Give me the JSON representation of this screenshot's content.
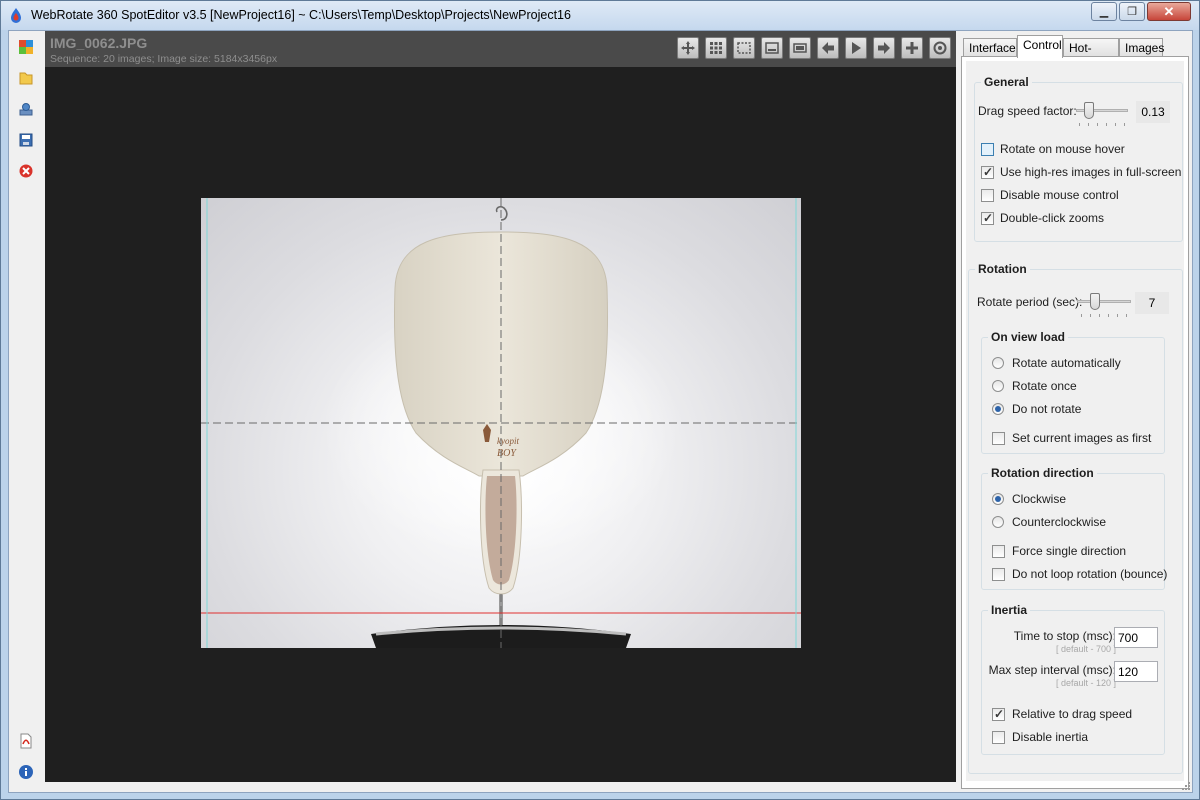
{
  "window": {
    "title": "WebRotate 360 SpotEditor v3.5 [NewProject16] ~ C:\\Users\\Temp\\Desktop\\Projects\\NewProject16"
  },
  "left_toolbar": {
    "items": [
      "cubes-icon",
      "open-folder-icon",
      "publish-icon",
      "save-icon",
      "close-project-icon",
      "pdf-icon",
      "info-icon"
    ]
  },
  "viewer": {
    "image_name": "IMG_0062.JPG",
    "info": "Sequence: 20 images; Image size: 5184x3456px",
    "toolbar": [
      "move-icon",
      "grid-icon",
      "select-region-icon",
      "filmstrip-icon",
      "fit-icon",
      "arrow-left-icon",
      "play-icon",
      "arrow-right-icon",
      "plus-icon",
      "target-icon"
    ],
    "product_logo_line1": "kyopit",
    "product_logo_line2": "BOY"
  },
  "tabs": [
    "Interface",
    "Control",
    "Hot-spots",
    "Images"
  ],
  "active_tab": "Control",
  "general": {
    "title": "General",
    "drag_speed_label": "Drag speed factor:",
    "drag_speed_value": "0.13",
    "drag_speed_fraction": 0.2,
    "options": [
      {
        "label": "Rotate on mouse hover",
        "checked": false
      },
      {
        "label": "Use high-res images in full-screen",
        "checked": true
      },
      {
        "label": "Disable mouse control",
        "checked": false
      },
      {
        "label": "Double-click zooms",
        "checked": true
      }
    ]
  },
  "rotation": {
    "title": "Rotation",
    "period_label": "Rotate period (sec):",
    "period_value": "7",
    "period_fraction": 0.3,
    "on_view_load": {
      "title": "On view load",
      "options": [
        {
          "label": "Rotate automatically",
          "selected": false
        },
        {
          "label": "Rotate once",
          "selected": false
        },
        {
          "label": "Do not rotate",
          "selected": true
        }
      ],
      "first_label": "Set current images as first",
      "first_checked": false
    },
    "direction": {
      "title": "Rotation direction",
      "options": [
        {
          "label": "Clockwise",
          "selected": true
        },
        {
          "label": "Counterclockwise",
          "selected": false
        }
      ],
      "force_label": "Force single direction",
      "bounce_label": "Do not loop rotation (bounce)"
    },
    "inertia": {
      "title": "Inertia",
      "time_label": "Time to stop (msc):",
      "time_hint": "[ default - 700 ]",
      "time_value": "700",
      "step_label": "Max step interval (msc):",
      "step_hint": "[ default - 120 ]",
      "step_value": "120",
      "relative_label": "Relative to drag speed",
      "relative_checked": true,
      "disable_label": "Disable inertia",
      "disable_checked": false
    }
  }
}
